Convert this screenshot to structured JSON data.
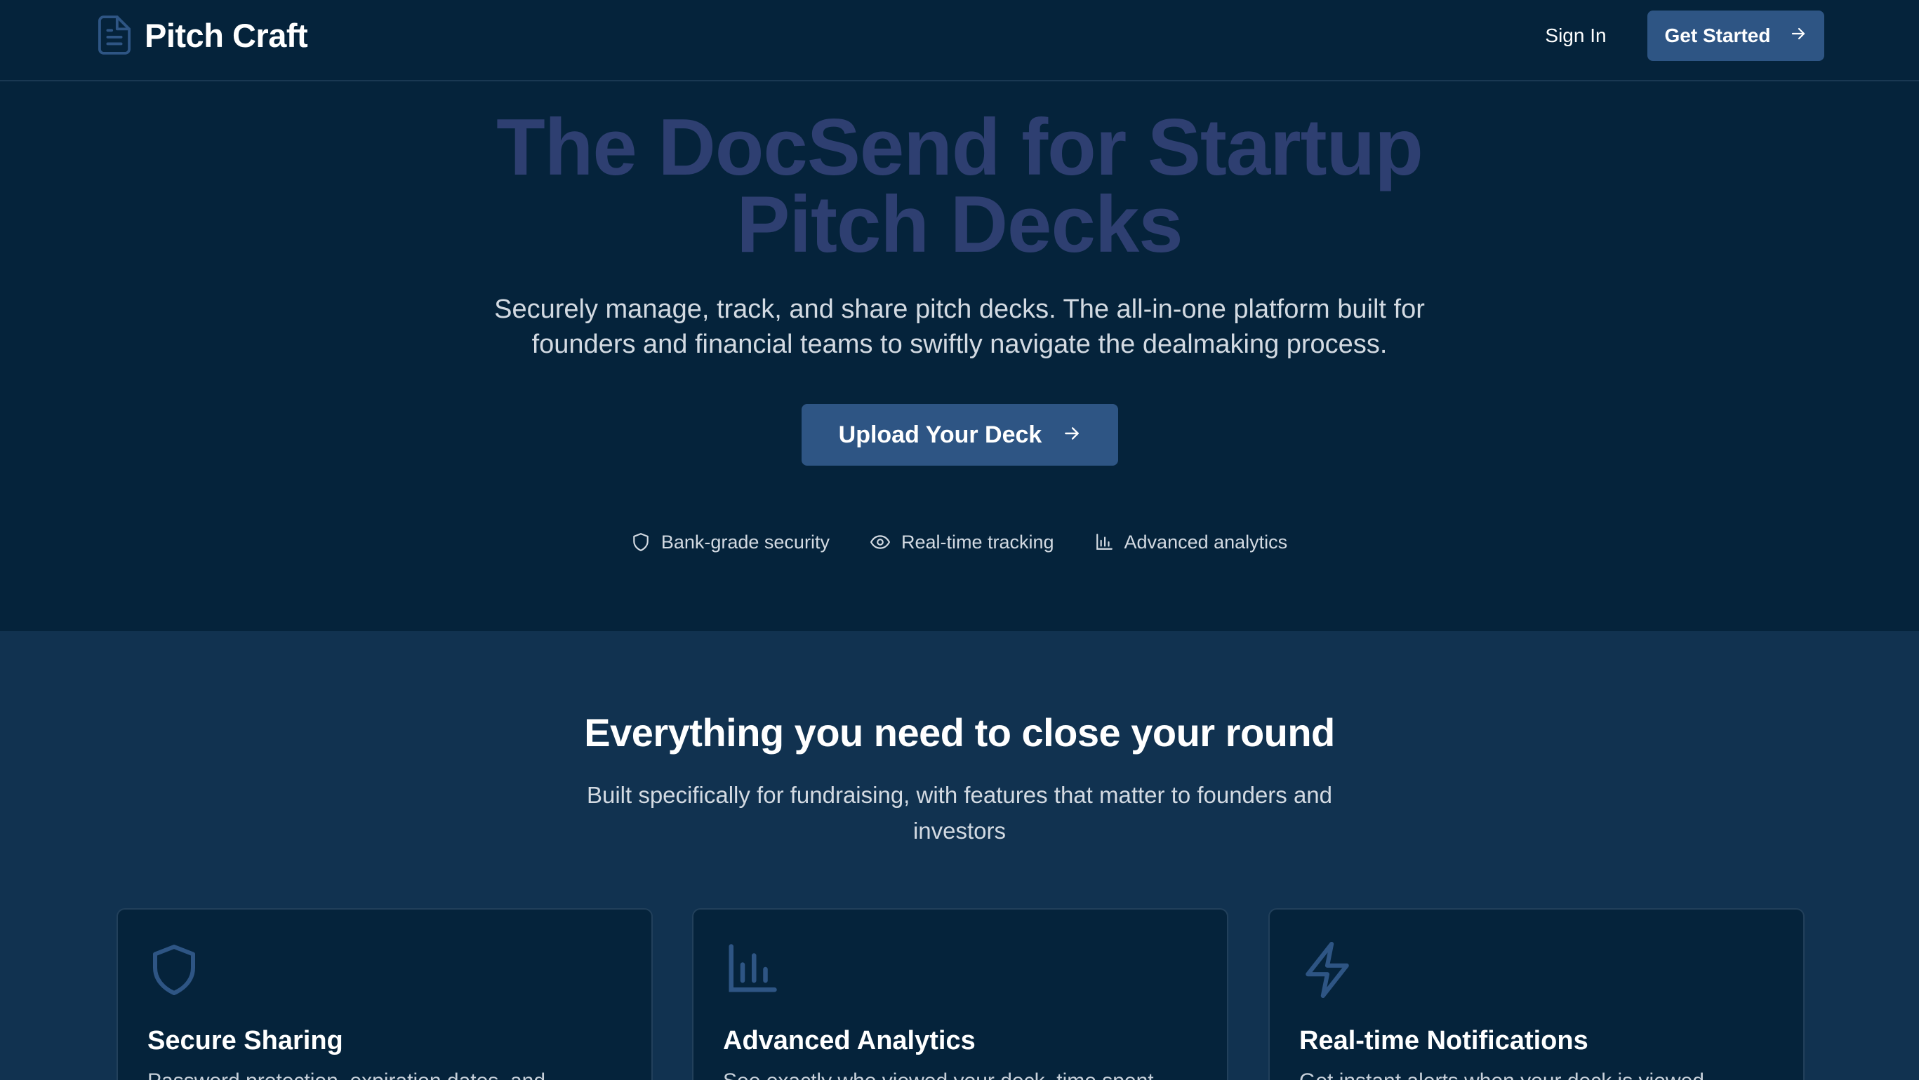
{
  "nav": {
    "brand": "Pitch Craft",
    "sign_in": "Sign In",
    "get_started": "Get Started"
  },
  "hero": {
    "title_line1": "The DocSend for Startup",
    "title_line2": "Pitch Decks",
    "subtitle_line1": "Securely manage, track, and share pitch decks. The all-in-one platform built for",
    "subtitle_line2": "founders and financial teams to swiftly navigate the dealmaking process.",
    "cta": "Upload Your Deck",
    "trust": [
      {
        "icon": "shield-icon",
        "label": "Bank-grade security"
      },
      {
        "icon": "eye-icon",
        "label": "Real-time tracking"
      },
      {
        "icon": "bar-chart-icon",
        "label": "Advanced analytics"
      }
    ]
  },
  "features": {
    "title": "Everything you need to close your round",
    "subtitle_line1": "Built specifically for fundraising, with features that matter to founders and",
    "subtitle_line2": "investors",
    "cards": [
      {
        "icon": "shield-icon",
        "title": "Secure Sharing",
        "desc": "Password protection, expiration dates, and"
      },
      {
        "icon": "bar-chart-icon",
        "title": "Advanced Analytics",
        "desc": "See exactly who viewed your deck, time spent"
      },
      {
        "icon": "lightning-icon",
        "title": "Real-time Notifications",
        "desc": "Get instant alerts when your deck is viewed"
      }
    ]
  },
  "colors": {
    "background": "#05233b",
    "section_background": "#113250",
    "accent": "#2e5584",
    "hero_title": "#2e3f71",
    "icon": "#2e5584"
  }
}
